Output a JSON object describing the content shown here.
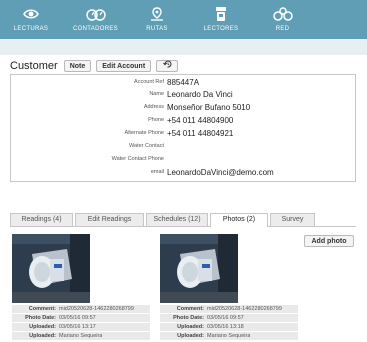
{
  "nav": {
    "items": [
      {
        "label": "LECTURAS",
        "icon": "eye-icon"
      },
      {
        "label": "CONTADORES",
        "icon": "meters-icon"
      },
      {
        "label": "RUTAS",
        "icon": "route-pin-icon"
      },
      {
        "label": "LECTORES",
        "icon": "readers-icon"
      },
      {
        "label": "RED",
        "icon": "network-icon"
      }
    ],
    "colors": {
      "bar": "#5f9eb4",
      "subbar": "#e8eff2"
    }
  },
  "customer": {
    "title": "Customer",
    "note_button": "Note",
    "edit_button": "Edit Account",
    "history_icon": "history-icon"
  },
  "info": {
    "rows": [
      {
        "label": "Account Ref",
        "value": "885447A"
      },
      {
        "label": "Name",
        "value": "Leonardo Da Vinci"
      },
      {
        "label": "Address",
        "value": "Monseñor Bufano 5010"
      },
      {
        "label": "Phone",
        "value": "+54 011 44804900"
      },
      {
        "label": "Alternate Phone",
        "value": "+54 011 44804921"
      },
      {
        "label": "Water Contact",
        "value": ""
      },
      {
        "label": "Water Contact Phone",
        "value": ""
      },
      {
        "label": "email",
        "value": "LeonardoDaVinci@demo.com"
      }
    ]
  },
  "tabs": [
    {
      "label": "Readings (4)"
    },
    {
      "label": "Edit Readings"
    },
    {
      "label": "Schedules (12)"
    },
    {
      "label": "Photos (2)",
      "active": true
    },
    {
      "label": "Survey"
    }
  ],
  "photos_panel": {
    "add_photo": "Add photo",
    "photos": [
      {
        "comment_label": "Comment:",
        "comment": "mid20520628-1462280268799",
        "date_label": "Photo Date:",
        "date": "03/05/16 09:57",
        "uploaded_label": "Uploaded:",
        "uploaded": "03/05/16 13:17",
        "uploader_label": "Uploaded:",
        "uploader": "Mariano Sequeira"
      },
      {
        "comment_label": "Comment:",
        "comment": "mid20520628-1462280268799",
        "date_label": "Photo Date:",
        "date": "03/05/16 09:57",
        "uploaded_label": "Uploaded:",
        "uploaded": "03/05/16 13:18",
        "uploader_label": "Uploaded:",
        "uploader": "Mariano Sequeira"
      }
    ]
  }
}
